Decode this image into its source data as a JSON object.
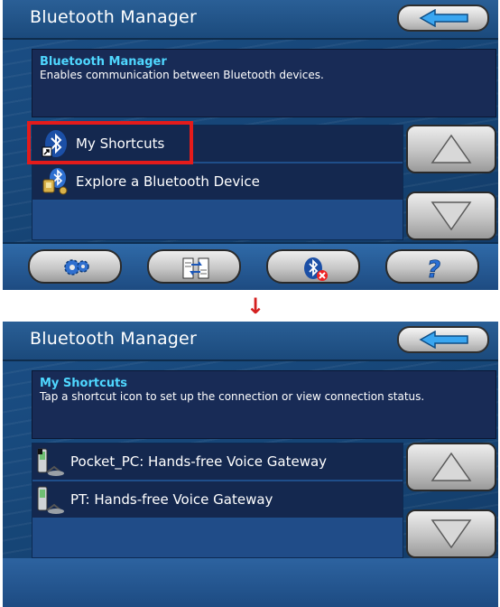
{
  "screens": [
    {
      "title": "Bluetooth Manager",
      "description": {
        "heading": "Bluetooth Manager",
        "text": "Enables communication between Bluetooth devices."
      },
      "items": [
        {
          "label": "My Shortcuts",
          "icon": "bluetooth-shortcut-icon",
          "highlighted": true
        },
        {
          "label": "Explore a Bluetooth Device",
          "icon": "explore-device-icon"
        }
      ],
      "toolbar": [
        "settings-gear-icon",
        "transfer-icon",
        "bluetooth-off-icon",
        "help-icon"
      ]
    },
    {
      "title": "Bluetooth Manager",
      "description": {
        "heading": "My Shortcuts",
        "text": "Tap a shortcut icon to set up the connection or view connection status."
      },
      "items": [
        {
          "label": "Pocket_PC: Hands-free Voice Gateway",
          "icon": "pda-connection-icon"
        },
        {
          "label": "PT: Hands-free Voice Gateway",
          "icon": "phone-connection-icon"
        }
      ]
    }
  ],
  "transition_arrow": "↓",
  "colors": {
    "accent": "#4fd7ff",
    "highlight": "#e41b1b",
    "background": "#174779"
  }
}
